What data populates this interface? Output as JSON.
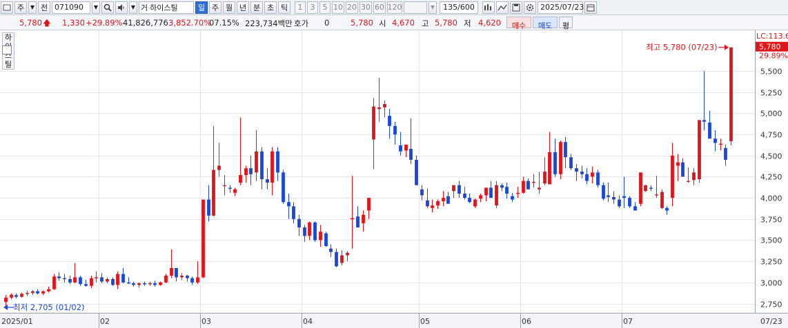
{
  "toolbar": {
    "period_label": "주",
    "market_label": "전",
    "stock_code": "071090",
    "search_icon": "search-icon",
    "sound_icon": "speaker-icon",
    "stock_prefix": "거",
    "stock_name": "하이스틸",
    "periods": [
      "일",
      "주",
      "월",
      "년",
      "분",
      "초",
      "틱"
    ],
    "intervals": [
      "1",
      "3",
      "5",
      "10",
      "20",
      "30",
      "60",
      "120"
    ],
    "count": "135",
    "count_total": "/600",
    "date": "2025/07/23",
    "calendar_icon": "calendar-icon"
  },
  "quote": {
    "price": "5,780",
    "change": "1,330",
    "change_pct": "+29.89%",
    "volume": "41,826,776",
    "volume_pct": "3,852.70%",
    "turnover": "07.15%",
    "amount": "223,734백만",
    "hoga_label": "호가",
    "hoga_value": "0",
    "hoga_price": "5,780",
    "open_label": "시",
    "open": "4,670",
    "high_label": "고",
    "high": "5,780",
    "low_label": "저",
    "low": "4,620",
    "buy_label": "매수",
    "sell_label": "매도",
    "avg_label": "평"
  },
  "legend": {
    "name": "하이스틸",
    "lc_label": "LC:113.6"
  },
  "chart_data": {
    "type": "candlestick",
    "y_ticks": [
      2750,
      3000,
      3250,
      3500,
      3750,
      4000,
      4250,
      4500,
      4750,
      5000,
      5250,
      5500
    ],
    "y_tick_labels": [
      "2,750",
      "3,000",
      "3,250",
      "3,500",
      "3,750",
      "4,000",
      "4,250",
      "4,500",
      "4,750",
      "5,000",
      "5,250",
      "5,500"
    ],
    "ylim": [
      2640,
      5900
    ],
    "x_labels": [
      "2025/01",
      "02",
      "03",
      "04",
      "05",
      "06",
      "07"
    ],
    "x_label_at_bar": [
      0,
      18,
      37,
      56,
      78,
      97,
      116
    ],
    "x_end_label": "07/23",
    "current_price_label": "5,780",
    "current_pct_label": "29.89%",
    "max_annotation": "최고 5,780 (07/23)",
    "min_annotation": "최저 2,705 (01/02)",
    "up_color": "#e0151b",
    "down_color": "#1a47d6",
    "candles": [
      [
        2770,
        2850,
        2705,
        2820
      ],
      [
        2820,
        2870,
        2800,
        2855
      ],
      [
        2850,
        2870,
        2810,
        2830
      ],
      [
        2830,
        2880,
        2820,
        2865
      ],
      [
        2865,
        2900,
        2840,
        2875
      ],
      [
        2875,
        2910,
        2850,
        2895
      ],
      [
        2895,
        2920,
        2860,
        2870
      ],
      [
        2870,
        2905,
        2850,
        2895
      ],
      [
        2895,
        2950,
        2880,
        2920
      ],
      [
        2920,
        3100,
        2910,
        3070
      ],
      [
        3070,
        3120,
        3020,
        3050
      ],
      [
        3050,
        3100,
        3000,
        3040
      ],
      [
        3040,
        3080,
        2980,
        3000
      ],
      [
        3000,
        3230,
        2990,
        3060
      ],
      [
        3060,
        3080,
        2960,
        2980
      ],
      [
        2980,
        3030,
        2950,
        2960
      ],
      [
        2960,
        3080,
        2930,
        3050
      ],
      [
        3050,
        3130,
        3000,
        3060
      ],
      [
        3060,
        3110,
        2990,
        3010
      ],
      [
        3010,
        3060,
        2990,
        3040
      ],
      [
        3040,
        3060,
        2960,
        2970
      ],
      [
        2970,
        3130,
        2920,
        3100
      ],
      [
        3100,
        3170,
        2990,
        3000
      ],
      [
        3000,
        3060,
        2980,
        2990
      ],
      [
        2990,
        3010,
        2950,
        2970
      ],
      [
        2970,
        3000,
        2940,
        2990
      ],
      [
        2990,
        3010,
        2960,
        2980
      ],
      [
        2980,
        3010,
        2960,
        2990
      ],
      [
        2990,
        3020,
        2950,
        2970
      ],
      [
        2970,
        3010,
        2960,
        3000
      ],
      [
        3000,
        3100,
        2990,
        3080
      ],
      [
        3080,
        3390,
        3050,
        3170
      ],
      [
        3170,
        3120,
        3010,
        3060
      ],
      [
        3060,
        3110,
        3030,
        3080
      ],
      [
        3080,
        3090,
        3010,
        3050
      ],
      [
        3050,
        3070,
        2970,
        3000
      ],
      [
        3000,
        3250,
        2980,
        3060
      ],
      [
        3060,
        3980,
        3050,
        3980
      ],
      [
        3980,
        4150,
        3720,
        3790
      ],
      [
        3790,
        4850,
        3780,
        4330
      ],
      [
        4330,
        4650,
        4250,
        4380
      ],
      [
        4150,
        4270,
        4030,
        4150
      ],
      [
        4120,
        4150,
        4060,
        4110
      ],
      [
        4060,
        4120,
        4020,
        4100
      ],
      [
        4180,
        4950,
        4150,
        4270
      ],
      [
        4270,
        4380,
        4180,
        4350
      ],
      [
        4350,
        4500,
        4150,
        4280
      ],
      [
        4300,
        4800,
        4200,
        4550
      ],
      [
        4550,
        4600,
        4100,
        4220
      ],
      [
        4220,
        4350,
        4100,
        4180
      ],
      [
        4180,
        4600,
        4030,
        4550
      ],
      [
        4550,
        4600,
        4200,
        4300
      ],
      [
        4300,
        4330,
        3930,
        3950
      ],
      [
        3950,
        4050,
        3750,
        3900
      ],
      [
        3900,
        3950,
        3700,
        3750
      ],
      [
        3750,
        3800,
        3550,
        3650
      ],
      [
        3650,
        3680,
        3480,
        3550
      ],
      [
        3550,
        3720,
        3500,
        3710
      ],
      [
        3710,
        3720,
        3480,
        3500
      ],
      [
        3500,
        3680,
        3420,
        3600
      ],
      [
        3580,
        3600,
        3420,
        3430
      ],
      [
        3400,
        3450,
        3300,
        3360
      ],
      [
        3360,
        3400,
        3180,
        3190
      ],
      [
        3230,
        3380,
        3200,
        3320
      ],
      [
        3320,
        3370,
        3250,
        3350
      ],
      [
        3750,
        4260,
        3400,
        3760
      ],
      [
        3780,
        3900,
        3650,
        3650
      ],
      [
        3700,
        3850,
        3600,
        3800
      ],
      [
        3850,
        4000,
        3750,
        4000
      ],
      [
        4690,
        5180,
        4340,
        5080
      ],
      [
        5050,
        5420,
        4900,
        5070
      ],
      [
        5070,
        5150,
        4950,
        5110
      ],
      [
        4970,
        5050,
        4700,
        4850
      ],
      [
        4850,
        4900,
        4630,
        4750
      ],
      [
        4620,
        4780,
        4500,
        4550
      ],
      [
        4560,
        4620,
        4480,
        4630
      ],
      [
        4580,
        4940,
        4400,
        4450
      ],
      [
        4450,
        4500,
        4150,
        4150
      ],
      [
        4100,
        4150,
        3970,
        4030
      ],
      [
        3970,
        4110,
        3880,
        3900
      ],
      [
        3880,
        3980,
        3830,
        3910
      ],
      [
        3910,
        3980,
        3870,
        3960
      ],
      [
        3960,
        4080,
        3900,
        4000
      ],
      [
        4020,
        4070,
        3930,
        3930
      ],
      [
        4080,
        4150,
        4000,
        4150
      ],
      [
        4150,
        4200,
        4000,
        4050
      ],
      [
        4050,
        4130,
        3980,
        4000
      ],
      [
        4000,
        4050,
        3940,
        3950
      ],
      [
        3900,
        3990,
        3880,
        3980
      ],
      [
        3990,
        4050,
        3950,
        4030
      ],
      [
        4030,
        4100,
        3960,
        4120
      ],
      [
        4120,
        4200,
        4000,
        4000
      ],
      [
        3910,
        4200,
        3880,
        4150
      ],
      [
        4150,
        4170,
        4080,
        4120
      ],
      [
        4130,
        4180,
        3990,
        4050
      ],
      [
        4020,
        4060,
        3950,
        3980
      ],
      [
        4050,
        4130,
        4000,
        4060
      ],
      [
        4060,
        4250,
        4050,
        4200
      ],
      [
        4200,
        4230,
        4110,
        4100
      ],
      [
        4180,
        4280,
        4120,
        4190
      ],
      [
        4100,
        4310,
        4050,
        4120
      ],
      [
        4170,
        4480,
        4150,
        4310
      ],
      [
        4160,
        4780,
        4160,
        4540
      ],
      [
        4540,
        4700,
        4250,
        4280
      ],
      [
        4280,
        4680,
        4220,
        4660
      ],
      [
        4660,
        4720,
        4350,
        4480
      ],
      [
        4480,
        4520,
        4330,
        4350
      ],
      [
        4350,
        4400,
        4200,
        4310
      ],
      [
        4310,
        4380,
        4230,
        4280
      ],
      [
        4280,
        4350,
        4160,
        4200
      ],
      [
        4250,
        4370,
        4170,
        4300
      ],
      [
        4300,
        4330,
        4120,
        4150
      ],
      [
        4150,
        4180,
        3970,
        3990
      ],
      [
        4030,
        4180,
        3950,
        4010
      ],
      [
        4010,
        4080,
        3930,
        3980
      ],
      [
        3980,
        4030,
        3880,
        3900
      ],
      [
        4020,
        4250,
        3880,
        4000
      ],
      [
        4000,
        4020,
        3880,
        3900
      ],
      [
        3900,
        3950,
        3850,
        3850
      ],
      [
        3930,
        4290,
        3900,
        4300
      ],
      [
        4080,
        4150,
        4070,
        4150
      ],
      [
        4120,
        4150,
        4080,
        4110
      ],
      [
        4030,
        4260,
        4000,
        4040
      ],
      [
        3880,
        4100,
        3870,
        4070
      ],
      [
        3880,
        3900,
        3800,
        3850
      ],
      [
        4000,
        4650,
        3900,
        4500
      ],
      [
        4380,
        4520,
        4200,
        4420
      ],
      [
        4420,
        4470,
        4250,
        4250
      ],
      [
        4200,
        4360,
        4180,
        4200
      ],
      [
        4210,
        4350,
        4150,
        4300
      ],
      [
        4220,
        4820,
        4180,
        4920
      ],
      [
        4920,
        5500,
        4800,
        4900
      ],
      [
        4890,
        5030,
        4720,
        4700
      ],
      [
        4700,
        4800,
        4550,
        4650
      ],
      [
        4640,
        4700,
        4560,
        4640
      ],
      [
        4590,
        4630,
        4380,
        4450
      ],
      [
        4670,
        5780,
        4620,
        5780
      ]
    ]
  }
}
